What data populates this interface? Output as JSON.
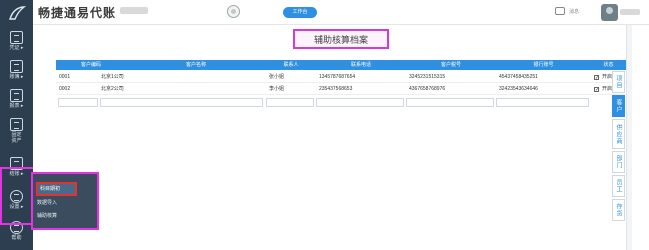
{
  "app": {
    "title": "畅捷通易代账",
    "top_button": "工作台",
    "messages_label": "消息"
  },
  "leftnav": {
    "items": [
      {
        "label": "凭证 ▸",
        "icon": "voucher-icon"
      },
      {
        "label": "账簿 ▸",
        "icon": "ledger-icon"
      },
      {
        "label": "报表 ▸",
        "icon": "report-icon"
      },
      {
        "label": "固定资产",
        "icon": "asset-icon"
      },
      {
        "label": "结账 ▸",
        "icon": "closing-icon"
      },
      {
        "label": "设置 ▸",
        "icon": "gear-icon"
      },
      {
        "label": "帮助",
        "icon": "help-icon"
      }
    ]
  },
  "popup": {
    "items": [
      "科目期初",
      "数据导入",
      "辅助核算"
    ]
  },
  "page": {
    "title": "辅助核算档案"
  },
  "table": {
    "headers": [
      "客户编码",
      "客户名称",
      "联系人",
      "联系电话",
      "客户税号",
      "银行账号",
      "状态"
    ],
    "rows": [
      {
        "code": "0001",
        "name": "北京1公司",
        "contact": "张小姐",
        "phone": "13457876876​54",
        "tax": "3245231515315",
        "bank": "45437458435251",
        "status": "开启",
        "enabled": true
      },
      {
        "code": "0002",
        "name": "北京2公司",
        "contact": "李小姐",
        "phone": "235437568653",
        "tax": "436765876​8976",
        "bank": "32423543634646",
        "status": "开启",
        "enabled": true
      }
    ]
  },
  "right_tabs": [
    {
      "label": "项目",
      "active": false
    },
    {
      "label": "客户",
      "active": true
    },
    {
      "label": "供应商",
      "active": false
    },
    {
      "label": "部门",
      "active": false
    },
    {
      "label": "员工",
      "active": false
    },
    {
      "label": "存货",
      "active": false
    }
  ],
  "colors": {
    "nav_bg": "#2d3e50",
    "accent": "#2f8fe0",
    "highlight_magenta": "#e234e0",
    "highlight_red": "#e03333"
  }
}
